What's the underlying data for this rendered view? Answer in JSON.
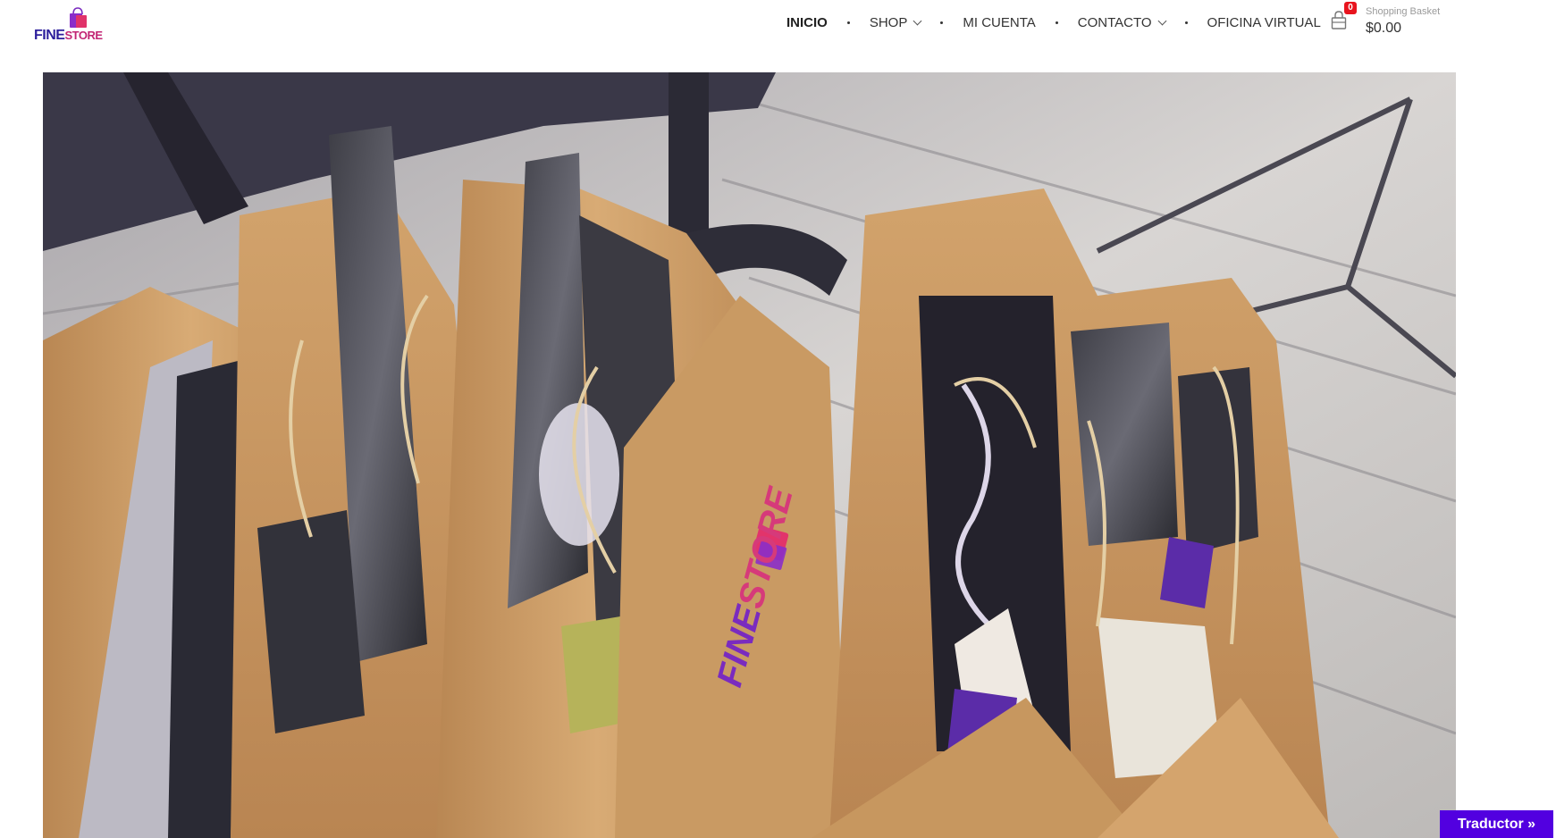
{
  "logo": {
    "part1": "FINE",
    "part2": "STORE"
  },
  "nav": {
    "items": [
      {
        "label": "INICIO",
        "active": true,
        "dropdown": false
      },
      {
        "label": "SHOP",
        "active": false,
        "dropdown": true
      },
      {
        "label": "MI CUENTA",
        "active": false,
        "dropdown": false
      },
      {
        "label": "CONTACTO",
        "active": false,
        "dropdown": true
      },
      {
        "label": "OFICINA VIRTUAL",
        "active": false,
        "dropdown": false
      }
    ]
  },
  "cart": {
    "count": "0",
    "label": "Shopping Basket",
    "total": "$0.00",
    "icon": "basket-icon"
  },
  "hero": {
    "bag_brand": "FINESTORE",
    "bag_brand_part1": "FINE",
    "bag_brand_part2": "STORE"
  },
  "translator": {
    "label": "Traductor »"
  },
  "colors": {
    "brand_dark": "#2d1f9c",
    "brand_pink": "#c22574",
    "badge": "#e8141e",
    "translator_bg": "#5200e0",
    "kraft": "#c99a63"
  }
}
